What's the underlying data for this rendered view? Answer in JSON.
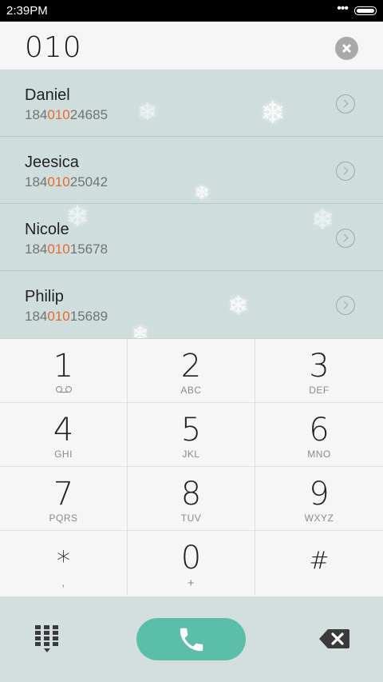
{
  "status_bar": {
    "time": "2:39PM",
    "dots": "•••"
  },
  "dialed_number": "010",
  "contacts": [
    {
      "name": "Daniel",
      "phone_prefix": "184",
      "phone_match": "010",
      "phone_suffix": "24685"
    },
    {
      "name": "Jeesica",
      "phone_prefix": "184",
      "phone_match": "010",
      "phone_suffix": "25042"
    },
    {
      "name": "Nicole",
      "phone_prefix": "184",
      "phone_match": "010",
      "phone_suffix": "15678"
    },
    {
      "name": "Philip",
      "phone_prefix": "184",
      "phone_match": "010",
      "phone_suffix": "15689"
    }
  ],
  "keys": [
    {
      "digit": "1",
      "letters": ""
    },
    {
      "digit": "2",
      "letters": "ABC"
    },
    {
      "digit": "3",
      "letters": "DEF"
    },
    {
      "digit": "4",
      "letters": "GHI"
    },
    {
      "digit": "5",
      "letters": "JKL"
    },
    {
      "digit": "6",
      "letters": "MNO"
    },
    {
      "digit": "7",
      "letters": "PQRS"
    },
    {
      "digit": "8",
      "letters": "TUV"
    },
    {
      "digit": "9",
      "letters": "WXYZ"
    },
    {
      "digit": "*",
      "letters": ","
    },
    {
      "digit": "0",
      "letters": "+"
    },
    {
      "digit": "#",
      "letters": ""
    }
  ],
  "colors": {
    "highlight": "#e66a2e",
    "call_button": "#5bbea8",
    "list_bg": "#d0dddd"
  },
  "icons": {
    "clear": "clear-circle-icon",
    "detail": "chevron-right-circle-icon",
    "voicemail": "voicemail-icon",
    "dialpad": "dialpad-icon",
    "call": "phone-icon",
    "backspace": "backspace-icon"
  }
}
